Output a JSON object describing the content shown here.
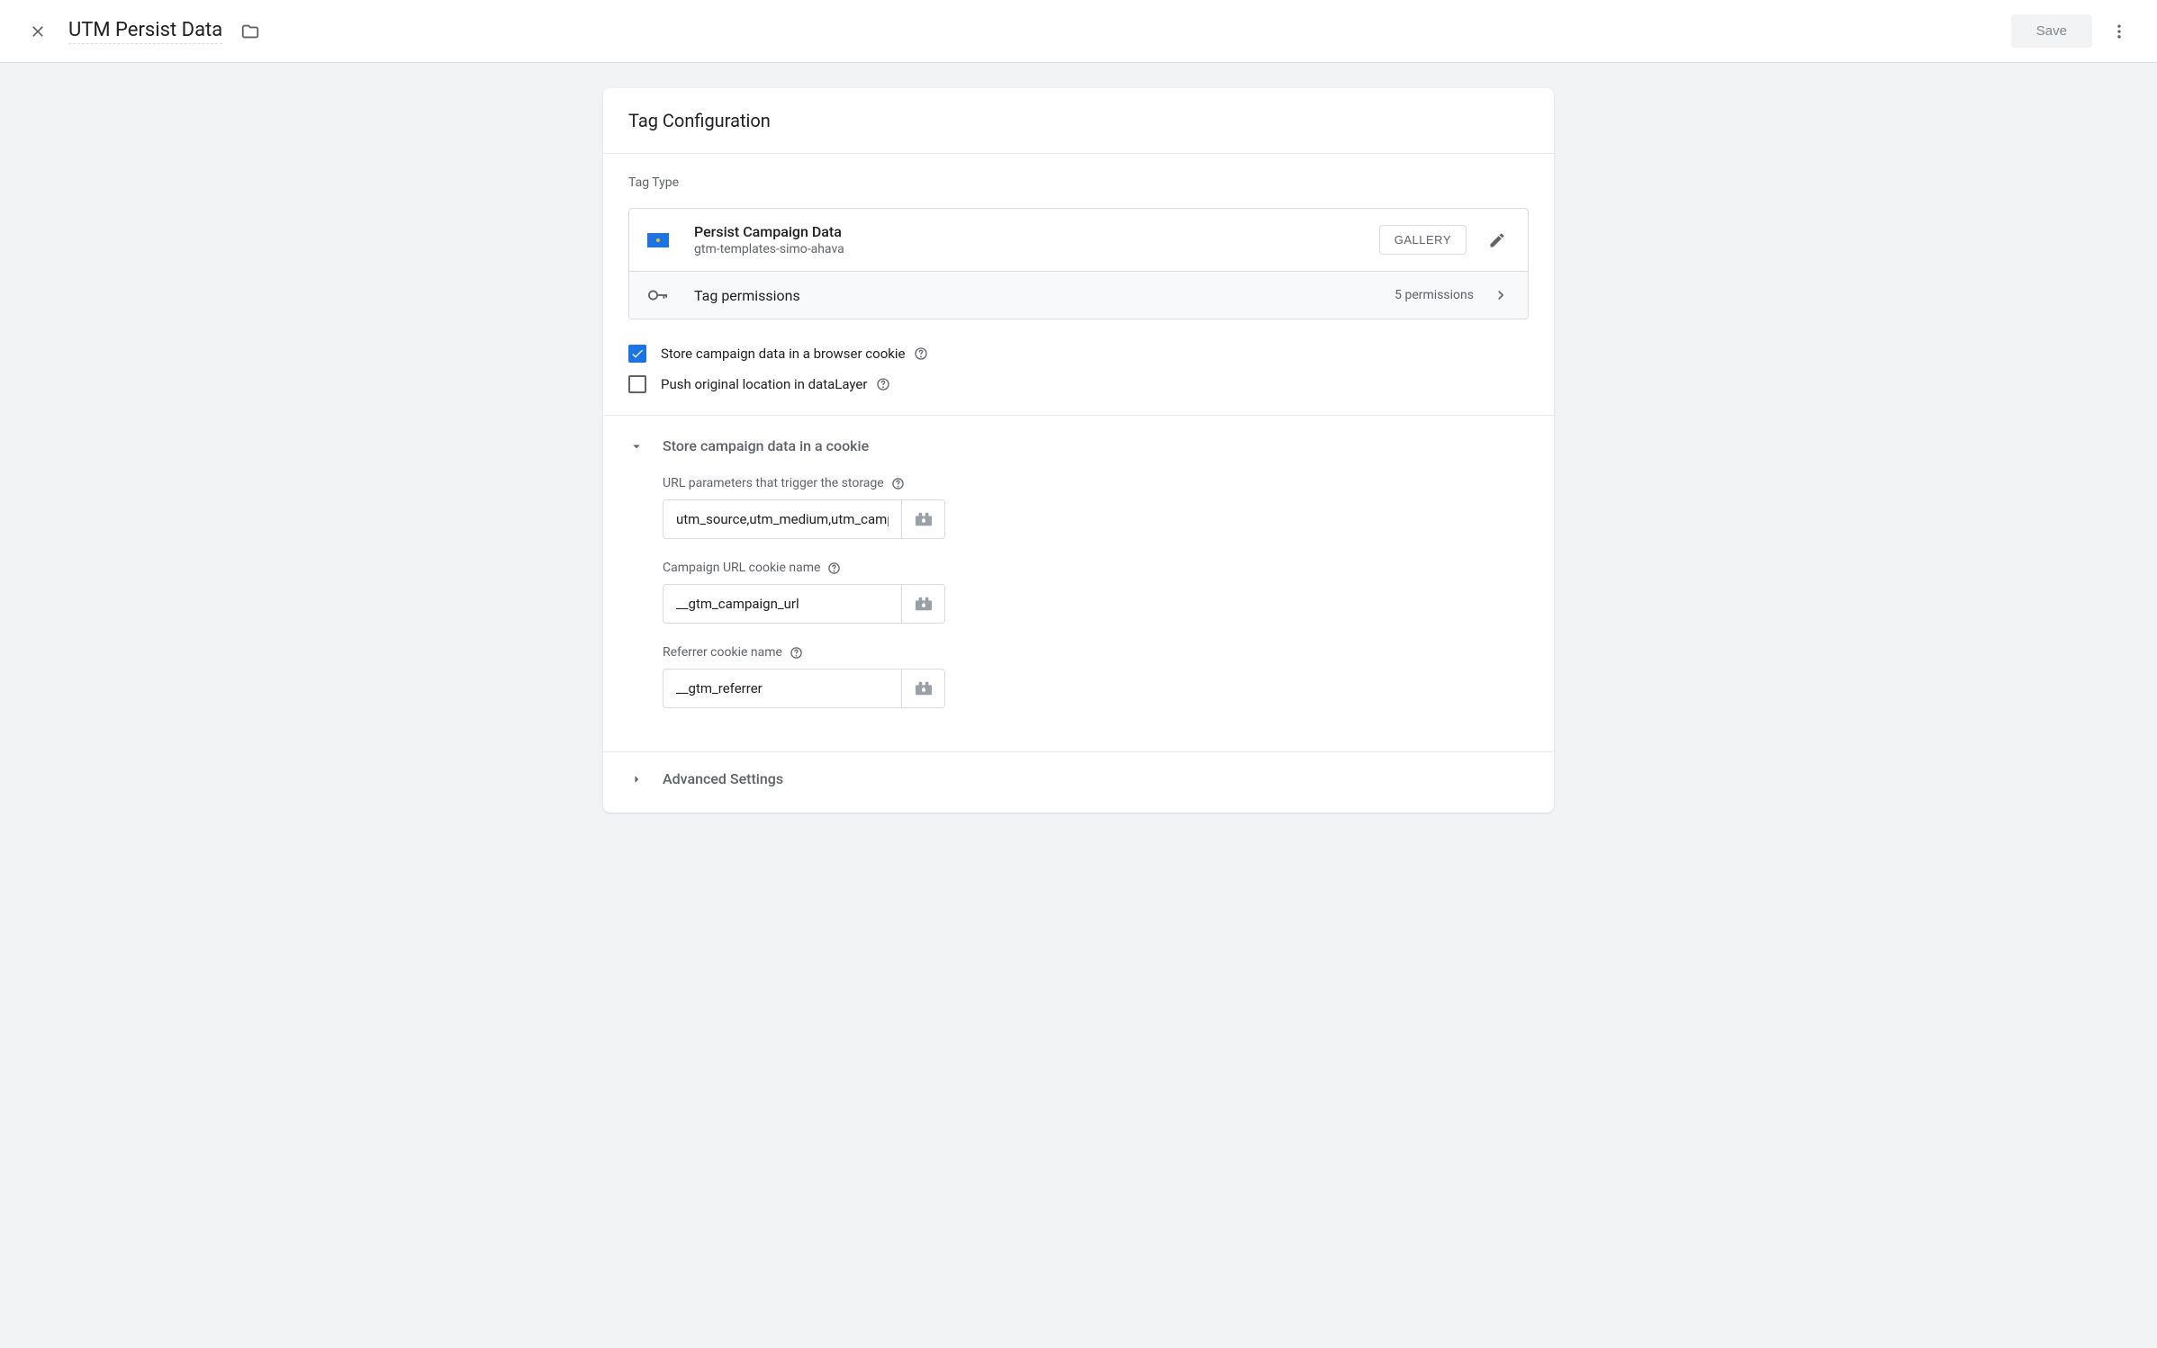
{
  "header": {
    "title": "UTM Persist Data",
    "save_label": "Save"
  },
  "card": {
    "title": "Tag Configuration",
    "tag_type_label": "Tag Type",
    "tag": {
      "name": "Persist Campaign Data",
      "author": "gtm-templates-simo-ahava",
      "gallery_label": "GALLERY"
    },
    "permissions": {
      "label": "Tag permissions",
      "count": "5 permissions"
    }
  },
  "checkboxes": {
    "store_cookie": {
      "label": "Store campaign data in a browser cookie",
      "checked": true
    },
    "push_datalayer": {
      "label": "Push original location in dataLayer",
      "checked": false
    }
  },
  "cookie_section": {
    "title": "Store campaign data in a cookie",
    "fields": {
      "url_params": {
        "label": "URL parameters that trigger the storage",
        "value": "utm_source,utm_medium,utm_campaign"
      },
      "campaign_cookie": {
        "label": "Campaign URL cookie name",
        "value": "__gtm_campaign_url"
      },
      "referrer_cookie": {
        "label": "Referrer cookie name",
        "value": "__gtm_referrer"
      }
    }
  },
  "advanced": {
    "title": "Advanced Settings"
  }
}
